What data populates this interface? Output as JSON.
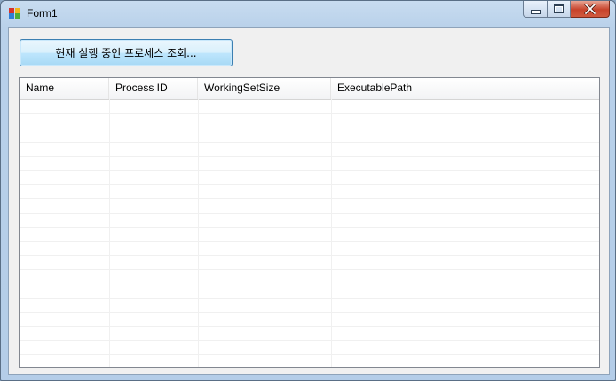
{
  "window": {
    "title": "Form1"
  },
  "main": {
    "query_button_label": "현재 실행 중인 프로세스 조회...",
    "process_list": {
      "columns": [
        "Name",
        "Process ID",
        "WorkingSetSize",
        "ExecutablePath"
      ],
      "rows": []
    }
  },
  "icons": {
    "app": "form-icon",
    "minimize": "minimize-icon",
    "maximize": "maximize-icon",
    "close": "close-icon"
  },
  "colors": {
    "close_button": "#c7432b",
    "button_border": "#3c7fb1",
    "client_background": "#f0f0f0"
  }
}
